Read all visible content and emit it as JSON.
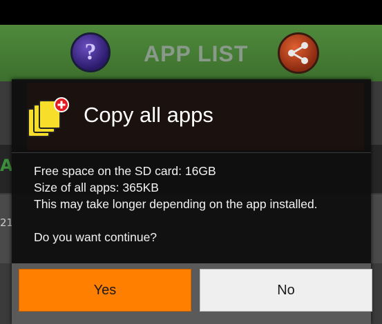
{
  "app": {
    "title": "APP LIST",
    "help_icon_glyph": "?",
    "help_icon": "help-icon",
    "share_icon": "share-icon",
    "bg_partial_left": "A",
    "bg_partial_number": "21"
  },
  "dialog": {
    "icon": "copy-icon",
    "title": "Copy all apps",
    "lines": [
      "Free space on the SD card: 16GB",
      "Size of all apps: 365KB",
      "This may take longer depending on the app installed."
    ],
    "question": "Do you want continue?",
    "yes_label": "Yes",
    "no_label": "No"
  },
  "colors": {
    "accent_button": "#ff7f00",
    "app_bar": "#4a8538",
    "dialog_bg": "#0e0e0e",
    "icon_yellow": "#f7de2a",
    "badge_red": "#e21b22"
  }
}
